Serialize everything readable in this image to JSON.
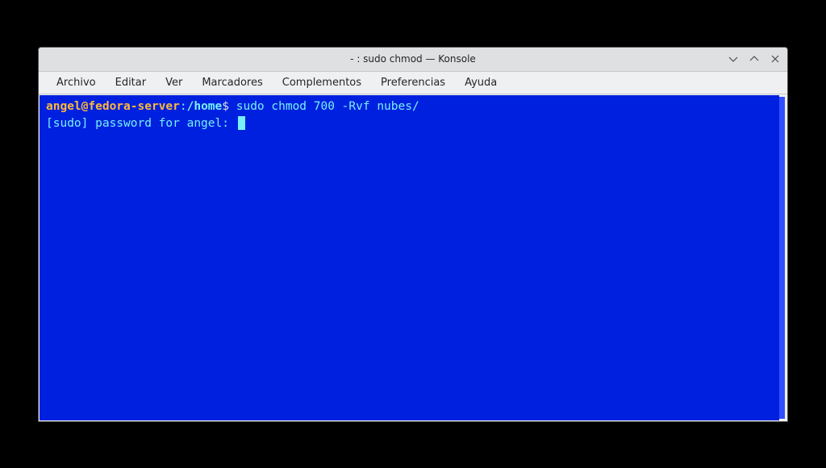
{
  "window": {
    "title": "- : sudo chmod — Konsole"
  },
  "menubar": {
    "items": [
      {
        "label": "Archivo"
      },
      {
        "label": "Editar"
      },
      {
        "label": "Ver"
      },
      {
        "label": "Marcadores"
      },
      {
        "label": "Complementos"
      },
      {
        "label": "Preferencias"
      },
      {
        "label": "Ayuda"
      }
    ]
  },
  "terminal": {
    "prompt": {
      "userhost": "angel@fedora-server",
      "colon": ":",
      "path": "/home",
      "dollar": "$"
    },
    "command": " sudo chmod 700 -Rvf nubes/",
    "sudo_prompt": "[sudo] password for angel: "
  }
}
